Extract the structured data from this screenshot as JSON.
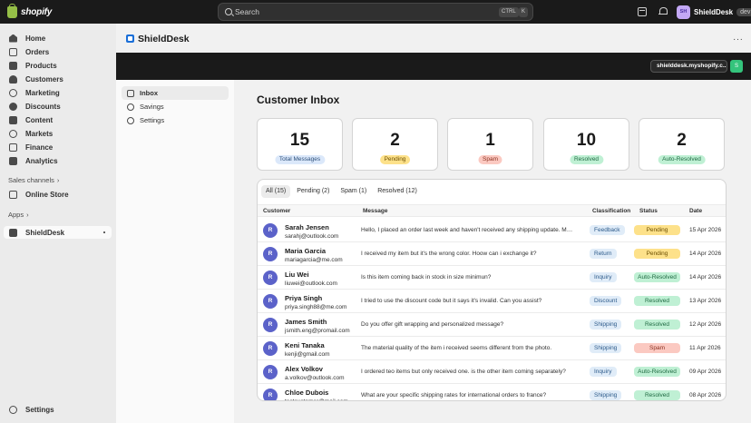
{
  "topbar": {
    "logo_text": "shopify",
    "search_placeholder": "Search",
    "kbd_ctrl": "CTRL",
    "kbd_k": "K",
    "user_initials": "SH",
    "user_name": "ShieldDesk",
    "user_badge": "dev"
  },
  "sidebar": {
    "items": [
      {
        "label": "Home",
        "icon": "home-icon"
      },
      {
        "label": "Orders",
        "icon": "orders-icon"
      },
      {
        "label": "Products",
        "icon": "tag-icon"
      },
      {
        "label": "Customers",
        "icon": "person-icon"
      },
      {
        "label": "Marketing",
        "icon": "target-icon"
      },
      {
        "label": "Discounts",
        "icon": "discount-icon"
      },
      {
        "label": "Content",
        "icon": "content-icon"
      },
      {
        "label": "Markets",
        "icon": "globe-icon"
      },
      {
        "label": "Finance",
        "icon": "bank-icon"
      },
      {
        "label": "Analytics",
        "icon": "chart-icon"
      }
    ],
    "sales_channels_title": "Sales channels",
    "online_store_label": "Online Store",
    "apps_title": "Apps",
    "app_item_label": "ShieldDesk",
    "settings_label": "Settings"
  },
  "app": {
    "title": "ShieldDesk",
    "more": "···",
    "store_url": "shielddesk.myshopify.c...",
    "store_button": "S"
  },
  "subnav": {
    "items": [
      {
        "label": "Inbox",
        "active": true
      },
      {
        "label": "Savings",
        "active": false
      },
      {
        "label": "Settings",
        "active": false
      }
    ]
  },
  "page": {
    "title": "Customer Inbox"
  },
  "stats": [
    {
      "value": "15",
      "label": "Total Messages",
      "bg": "#dbe8fa",
      "fg": "#2c4f7a"
    },
    {
      "value": "2",
      "label": "Pending",
      "bg": "#fde18a",
      "fg": "#6b4e00"
    },
    {
      "value": "1",
      "label": "Spam",
      "bg": "#fbc9c1",
      "fg": "#8a2f1f"
    },
    {
      "value": "10",
      "label": "Resolved",
      "bg": "#bff0d4",
      "fg": "#1f6a42"
    },
    {
      "value": "2",
      "label": "Auto-Resolved",
      "bg": "#bff0d4",
      "fg": "#1f6a42"
    }
  ],
  "tabs": [
    {
      "label": "All",
      "count": "(15)",
      "active": true
    },
    {
      "label": "Pending",
      "count": "(2)",
      "active": false
    },
    {
      "label": "Spam",
      "count": "(1)",
      "active": false
    },
    {
      "label": "Resolved",
      "count": "(12)",
      "active": false
    }
  ],
  "table": {
    "headers": {
      "customer": "Customer",
      "message": "Message",
      "classification": "Classification",
      "status": "Status",
      "date": "Date"
    },
    "rows": [
      {
        "initial": "R",
        "name": "Sarah Jensen",
        "email": "sarahj@outlook.com",
        "message": "Hello, I placed an order last week and haven't received any shipping update. My ...",
        "classification": "Feedback",
        "status": "Pending",
        "date": "15 Apr 2026"
      },
      {
        "initial": "R",
        "name": "Maria Garcia",
        "email": "mariagarcia@me.com",
        "message": "I received my item but it's the wrong color. Hoow can i exchange it?",
        "classification": "Return",
        "status": "Pending",
        "date": "14 Apr 2026"
      },
      {
        "initial": "R",
        "name": "Liu Wei",
        "email": "liuwei@outlook.com",
        "message": "Is this item coming back in stock in size minimun?",
        "classification": "Inquiry",
        "status": "Auto-Resolved",
        "date": "14 Apr 2026"
      },
      {
        "initial": "R",
        "name": "Priya Singh",
        "email": "priya.singh88@me.com",
        "message": "I tried to use the discount code but it says it's invalid. Can you assist?",
        "classification": "Discount",
        "status": "Resolved",
        "date": "13 Apr 2026"
      },
      {
        "initial": "R",
        "name": "James Smith",
        "email": "jsmith.eng@promail.com",
        "message": "Do you offer gift wrapping and personalized message?",
        "classification": "Shipping",
        "status": "Resolved",
        "date": "12 Apr 2026"
      },
      {
        "initial": "R",
        "name": "Keni Tanaka",
        "email": "kenji@gmail.com",
        "message": "The material quality of the item i received seems different from the photo.",
        "classification": "Shipping",
        "status": "Spam",
        "date": "11 Apr 2026"
      },
      {
        "initial": "R",
        "name": "Alex Volkov",
        "email": "a.volkov@outlook.com",
        "message": "I ordered teo items but only received one. is the other item coming separately?",
        "classification": "Inquiry",
        "status": "Auto-Resolved",
        "date": "09 Apr 2026"
      },
      {
        "initial": "R",
        "name": "Chloe Dubois",
        "email": "testcustomer@mail.com",
        "message": "What are your specific shipping rates for international orders to france?",
        "classification": "Shipping",
        "status": "Resolved",
        "date": "08 Apr 2026"
      }
    ]
  },
  "status_colors": {
    "Pending": {
      "bg": "#fde18a",
      "fg": "#6b4e00"
    },
    "Auto-Resolved": {
      "bg": "#bff0d4",
      "fg": "#1f6a42"
    },
    "Resolved": {
      "bg": "#bff0d4",
      "fg": "#1f6a42"
    },
    "Spam": {
      "bg": "#fbc9c1",
      "fg": "#8a2f1f"
    }
  }
}
